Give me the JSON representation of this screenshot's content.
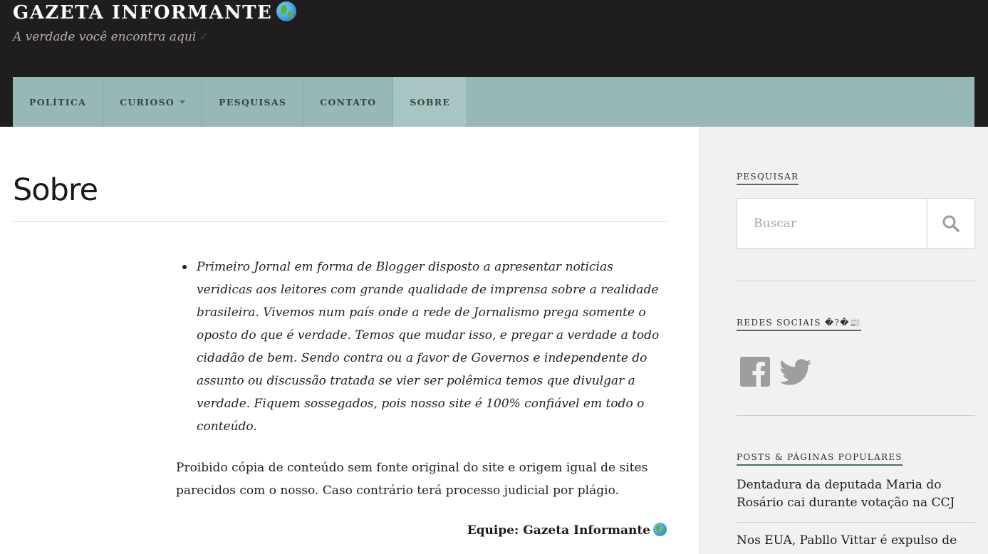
{
  "site": {
    "title": "GAZETA INFORMANTE",
    "tagline": "A verdade você encontra aqui"
  },
  "nav": {
    "items": [
      {
        "label": "POLÍTICA"
      },
      {
        "label": "CURIOSO"
      },
      {
        "label": "PESQUISAS"
      },
      {
        "label": "CONTATO"
      },
      {
        "label": "SOBRE"
      }
    ],
    "active": "SOBRE"
  },
  "page": {
    "title": "Sobre",
    "bullet_text": "Primeiro Jornal em forma de Blogger disposto a apresentar noticias veridicas aos leitores com grande qualidade de imprensa sobre a realidade brasileira. Vivemos num país onde a rede de Jornalismo prega somente o oposto do que é verdade. Temos que mudar isso, e pregar a verdade a todo cidadão de bem. Sendo contra ou a favor de Governos e independente do assunto ou discussão tratada se vier ser polêmica temos que divulgar a verdade. Fiquem sossegados, pois nosso site é 100% confiável em todo o conteúdo.",
    "paragraph": "Proibido cópia de conteúdo sem fonte original do site e origem igual de sites parecidos com o nosso. Caso contrário terá processo judicial por plágio.",
    "signature": "Equipe: Gazeta Informante"
  },
  "sidebar": {
    "search": {
      "title": "PESQUISAR",
      "placeholder": "Buscar"
    },
    "social": {
      "title": "REDES SOCIAIS �?�📰",
      "icons": [
        "facebook-icon",
        "twitter-icon"
      ]
    },
    "popular": {
      "title": "POSTS & PÁGINAS POPULARES",
      "links": [
        "Dentadura da deputada Maria do Rosário cai durante votação na CCJ",
        "Nos EUA, Pabllo Vittar é expulso de"
      ]
    }
  },
  "colors": {
    "header_bg": "#1f1d1d",
    "nav_bg": "#97b8b6",
    "nav_active": "#a6c5c3",
    "sidebar_bg": "#f1f1f1",
    "accent": "#4d6b69"
  }
}
